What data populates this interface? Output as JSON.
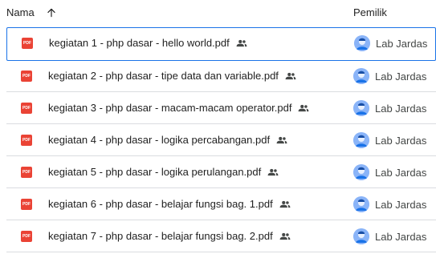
{
  "header": {
    "name_label": "Nama",
    "sort_icon": "arrow-up-icon",
    "owner_label": "Pemilik"
  },
  "files": [
    {
      "name": "kegiatan 1 - php dasar - hello world.pdf",
      "owner": "Lab Jardas",
      "icon": "pdf-icon",
      "shared": true,
      "selected": true
    },
    {
      "name": "kegiatan 2 - php dasar - tipe data dan variable.pdf",
      "owner": "Lab Jardas",
      "icon": "pdf-icon",
      "shared": true,
      "selected": false
    },
    {
      "name": "kegiatan 3 - php dasar - macam-macam operator.pdf",
      "owner": "Lab Jardas",
      "icon": "pdf-icon",
      "shared": true,
      "selected": false
    },
    {
      "name": "kegiatan 4 - php dasar - logika percabangan.pdf",
      "owner": "Lab Jardas",
      "icon": "pdf-icon",
      "shared": true,
      "selected": false
    },
    {
      "name": "kegiatan 5 - php dasar - logika perulangan.pdf",
      "owner": "Lab Jardas",
      "icon": "pdf-icon",
      "shared": true,
      "selected": false
    },
    {
      "name": "kegiatan 6 - php dasar - belajar fungsi bag. 1.pdf",
      "owner": "Lab Jardas",
      "icon": "pdf-icon",
      "shared": true,
      "selected": false
    },
    {
      "name": "kegiatan 7 - php dasar - belajar fungsi bag. 2.pdf",
      "owner": "Lab Jardas",
      "icon": "pdf-icon",
      "shared": true,
      "selected": false
    }
  ],
  "pdf_badge_text": "PDF",
  "colors": {
    "pdf_red": "#ea4335",
    "selection_blue": "#1a73e8",
    "divider": "#dadce0",
    "avatar_blue": "#8ab4f8"
  }
}
